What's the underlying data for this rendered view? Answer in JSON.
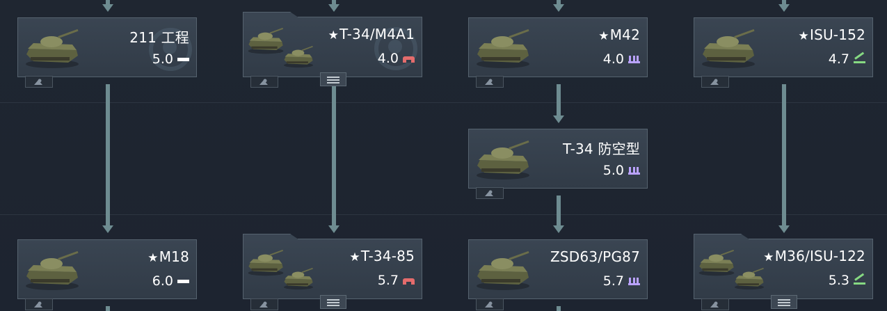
{
  "rows": [
    [
      {
        "id": "c1",
        "name": "211 工程",
        "premium": false,
        "br": "5.0",
        "cls": "heavy",
        "group": false,
        "emblem": true,
        "tank_icon": "tank-icon"
      },
      {
        "id": "c2",
        "name": "T-34/M4A1",
        "premium": true,
        "br": "4.0",
        "cls": "medium",
        "group": true,
        "emblem": true,
        "tank_icon": "tank-group-icon"
      },
      {
        "id": "c3",
        "name": "M42",
        "premium": true,
        "br": "4.0",
        "cls": "spaa",
        "group": false,
        "emblem": false,
        "tank_icon": "spaa-icon"
      },
      {
        "id": "c4",
        "name": "ISU-152",
        "premium": true,
        "br": "4.7",
        "cls": "td",
        "group": false,
        "emblem": false,
        "tank_icon": "tank-destroyer-icon"
      }
    ],
    [
      {
        "id": "c5",
        "name": "T-34 防空型",
        "premium": false,
        "br": "5.0",
        "cls": "spaa",
        "group": false,
        "emblem": false,
        "tank_icon": "spaa-icon"
      }
    ],
    [
      {
        "id": "c6",
        "name": "M18",
        "premium": true,
        "br": "6.0",
        "cls": "heavy",
        "group": false,
        "emblem": false,
        "tank_icon": "tank-destroyer-icon"
      },
      {
        "id": "c7",
        "name": "T-34-85",
        "premium": true,
        "br": "5.7",
        "cls": "medium",
        "group": true,
        "emblem": false,
        "tank_icon": "tank-group-icon"
      },
      {
        "id": "c8",
        "name": "ZSD63/PG87",
        "premium": false,
        "br": "5.7",
        "cls": "spaa",
        "group": false,
        "emblem": false,
        "tank_icon": "spaa-icon"
      },
      {
        "id": "c9",
        "name": "M36/ISU-122",
        "premium": true,
        "br": "5.3",
        "cls": "td",
        "group": true,
        "emblem": false,
        "tank_icon": "tank-group-icon"
      }
    ]
  ],
  "premium_star": "★",
  "colors": {
    "heavy": "#ffffff",
    "medium": "#e46c6c",
    "spaa": "#b9a2ff",
    "td": "#86d982"
  }
}
